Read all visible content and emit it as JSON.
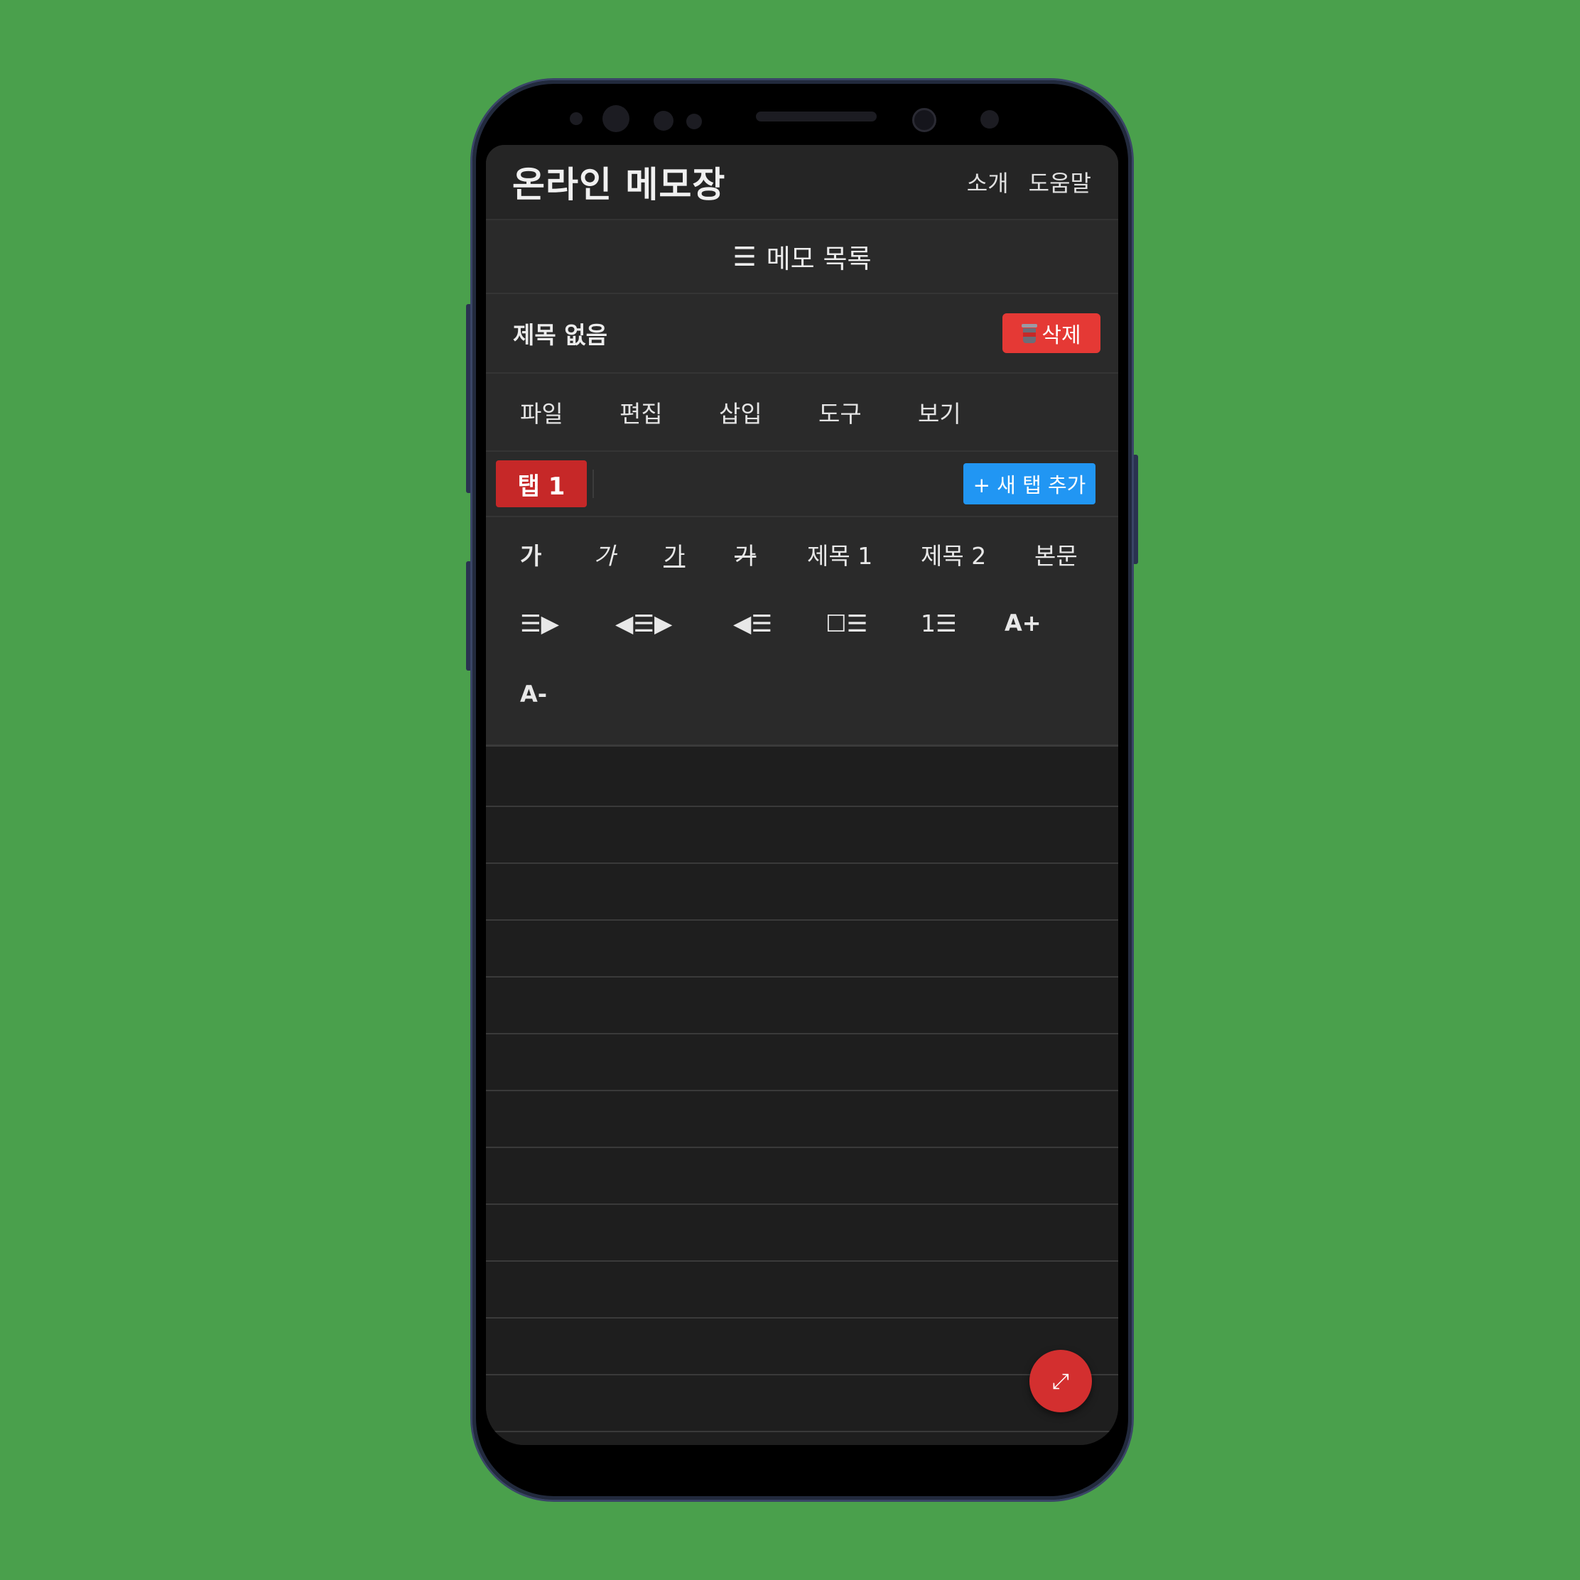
{
  "header": {
    "title": "온라인 메모장",
    "links": [
      "소개",
      "도움말"
    ]
  },
  "memo_list": {
    "icon": "☰",
    "label": "메모 목록"
  },
  "memo": {
    "title": "제목 없음",
    "delete_label": "삭제",
    "delete_icon": "trash-icon"
  },
  "menu": {
    "items": [
      "파일",
      "편집",
      "삽입",
      "도구",
      "보기"
    ]
  },
  "tabs": {
    "items": [
      "탭 1"
    ],
    "add_label": "+ 새 탭 추가"
  },
  "format": {
    "bold": "가",
    "italic": "가",
    "underline": "가",
    "strike": "가",
    "heading1": "제목 1",
    "heading2": "제목 2",
    "body": "본문",
    "indent": "☰▶",
    "center": "◀☰▶",
    "outdent": "◀☰",
    "checklist": "☐☰",
    "numbered": "1☰",
    "font_up": "A+",
    "font_down": "A-"
  },
  "fab": {
    "icon": "expand-icon",
    "glyph": "⤢"
  },
  "colors": {
    "background": "#4aa04c",
    "delete": "#e53935",
    "tab_active": "#c62828",
    "add_tab": "#2196f3",
    "fab": "#d32f2f"
  }
}
